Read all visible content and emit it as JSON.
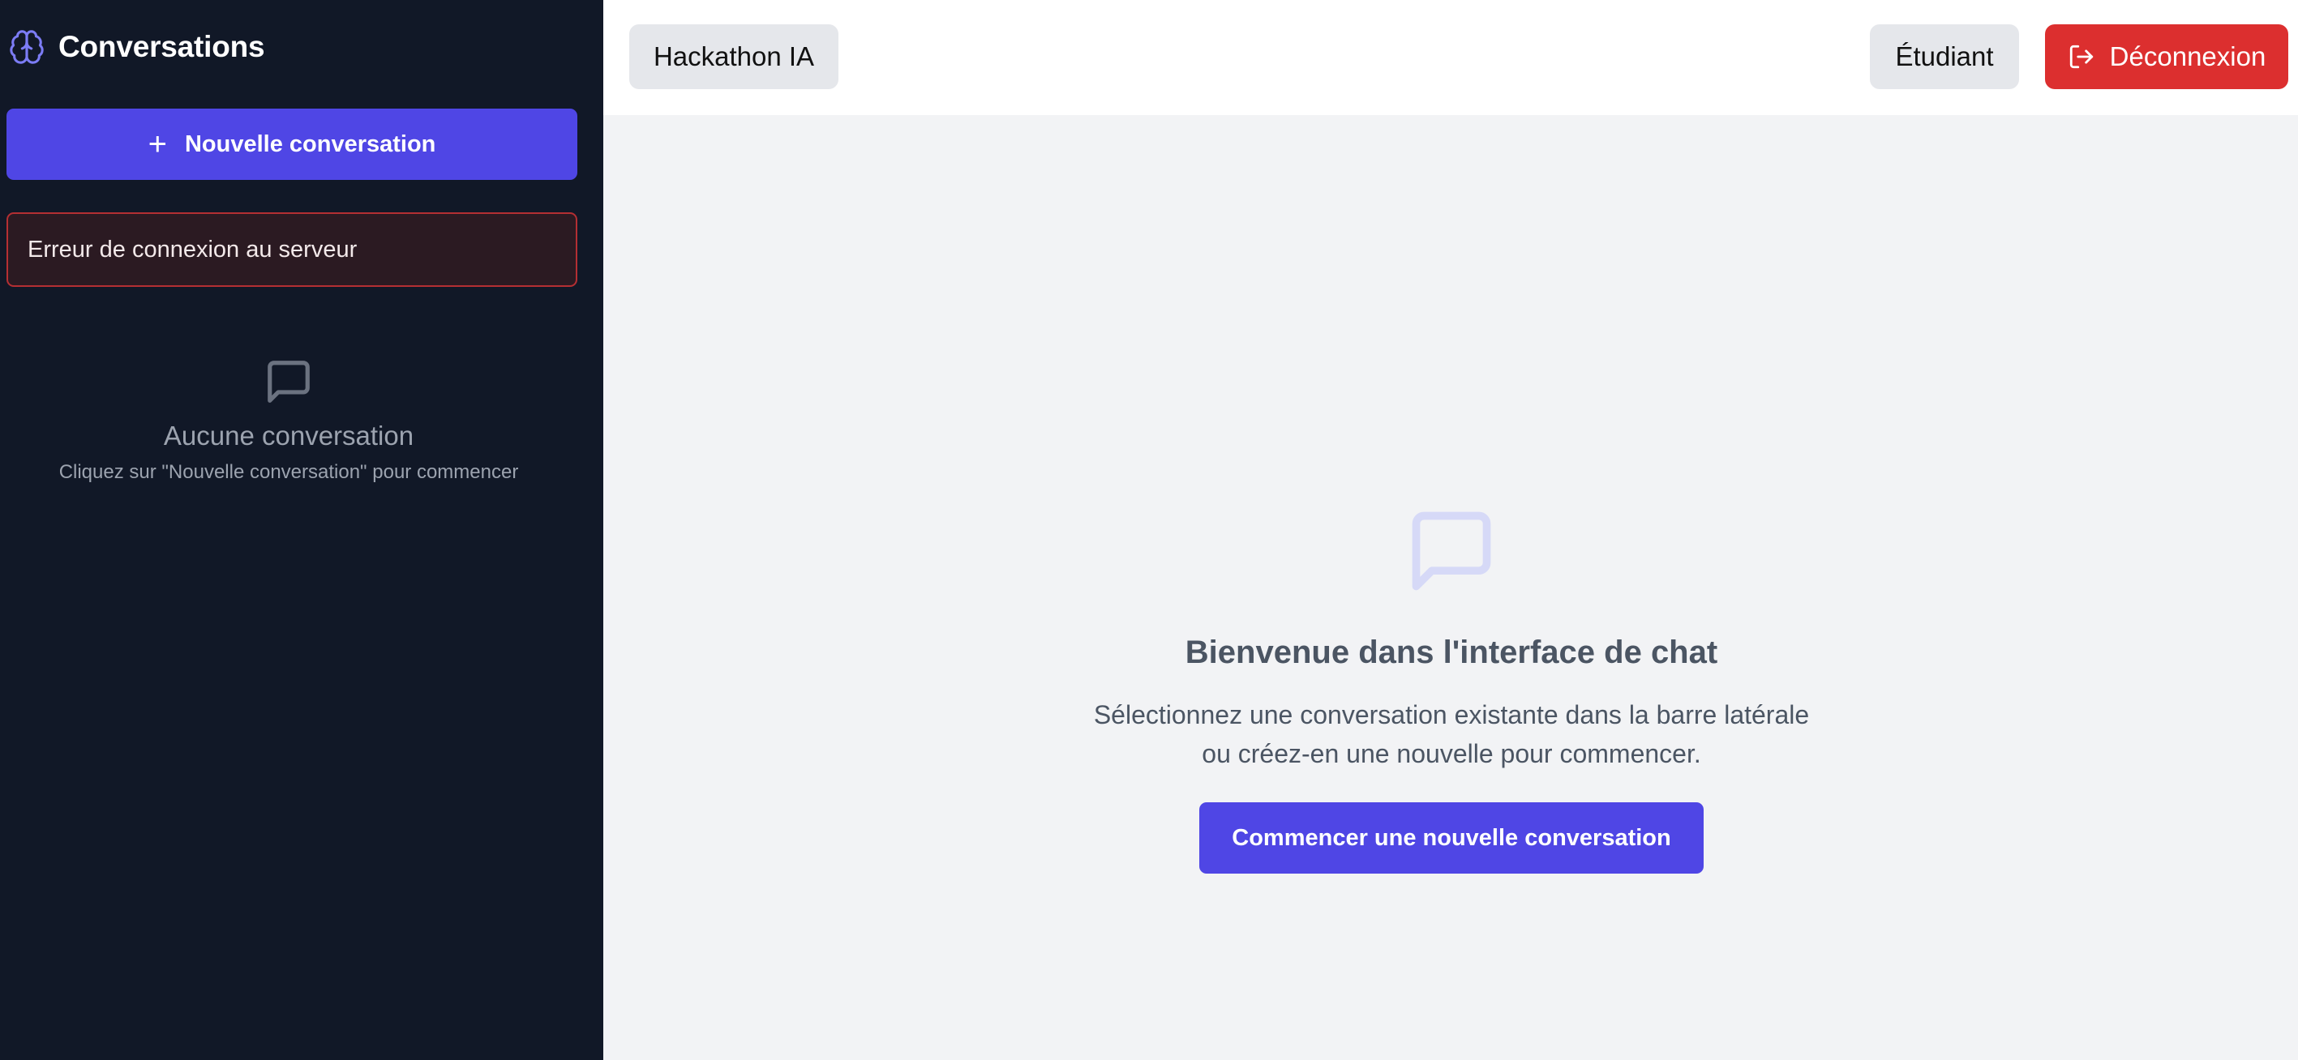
{
  "sidebar": {
    "title": "Conversations",
    "brand_icon": "brain-icon",
    "new_conversation_label": "Nouvelle conversation",
    "error_message": "Erreur de connexion au serveur",
    "empty": {
      "icon": "chat-bubble-icon",
      "title": "Aucune conversation",
      "hint": "Cliquez sur \"Nouvelle conversation\" pour commencer"
    }
  },
  "header": {
    "project_label": "Hackathon IA",
    "role_label": "Étudiant",
    "logout_label": "Déconnexion",
    "logout_icon": "logout-icon"
  },
  "main": {
    "welcome_icon": "chat-bubble-icon",
    "title": "Bienvenue dans l'interface de chat",
    "description_line1": "Sélectionnez une conversation existante dans la barre latérale",
    "description_line2": "ou créez-en une nouvelle pour commencer.",
    "start_button_label": "Commencer une nouvelle conversation"
  },
  "colors": {
    "sidebar_bg": "#111827",
    "accent": "#4f46e5",
    "danger": "#dc2f2f",
    "main_bg": "#f2f3f5"
  }
}
